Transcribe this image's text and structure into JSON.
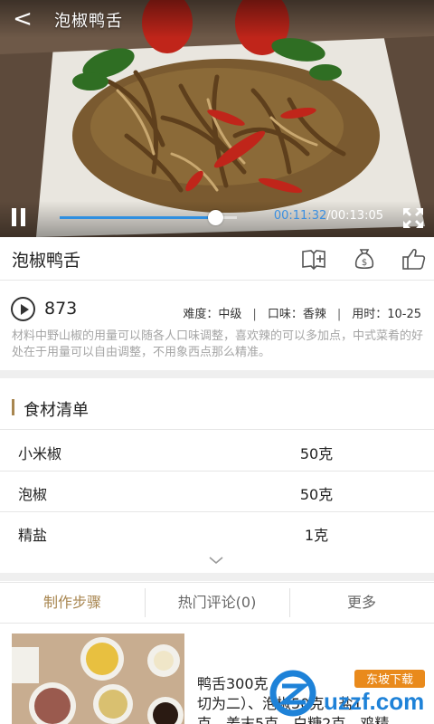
{
  "video": {
    "back_glyph": "<",
    "title": "泡椒鸭舌",
    "progress": 0.88,
    "current_time": "00:11:32",
    "total_time": "/00:13:05",
    "state": "playing"
  },
  "recipe": {
    "name": "泡椒鸭舌",
    "actions": [
      "book-add-icon",
      "money-bag-icon",
      "thumbs-up-icon"
    ],
    "views": "873",
    "difficulty": "难度：中级",
    "taste": "口味：香辣",
    "time": "用时：10-25",
    "separator": "|",
    "description": "材料中野山椒的用量可以随各人口味调整，喜欢辣的可以多加点，中式菜肴的好处在于用量可以自由调整，不用象西点那么精准。"
  },
  "ingredients": {
    "title": "食材清单",
    "items": [
      {
        "name": "小米椒",
        "amount": "50克"
      },
      {
        "name": "泡椒",
        "amount": "50克"
      },
      {
        "name": "精盐",
        "amount": "1克"
      }
    ]
  },
  "tabs": [
    {
      "label": "制作步骤",
      "active": true
    },
    {
      "label": "热门评论(0)",
      "active": false
    },
    {
      "label": "更多",
      "active": false
    }
  ],
  "step": {
    "line1": "鸭舌300克",
    "line2": "切为二）、泡椒50克、盐1",
    "line3": "克、姜末5克、白糖2克、鸡精"
  },
  "watermark": {
    "brand": "uzzf.com",
    "tag": "东坡下载"
  },
  "colors": {
    "accent": "#a88650",
    "progress": "#2f8fe0",
    "muted_text": "#a5a5a5",
    "divider": "#efefef"
  }
}
